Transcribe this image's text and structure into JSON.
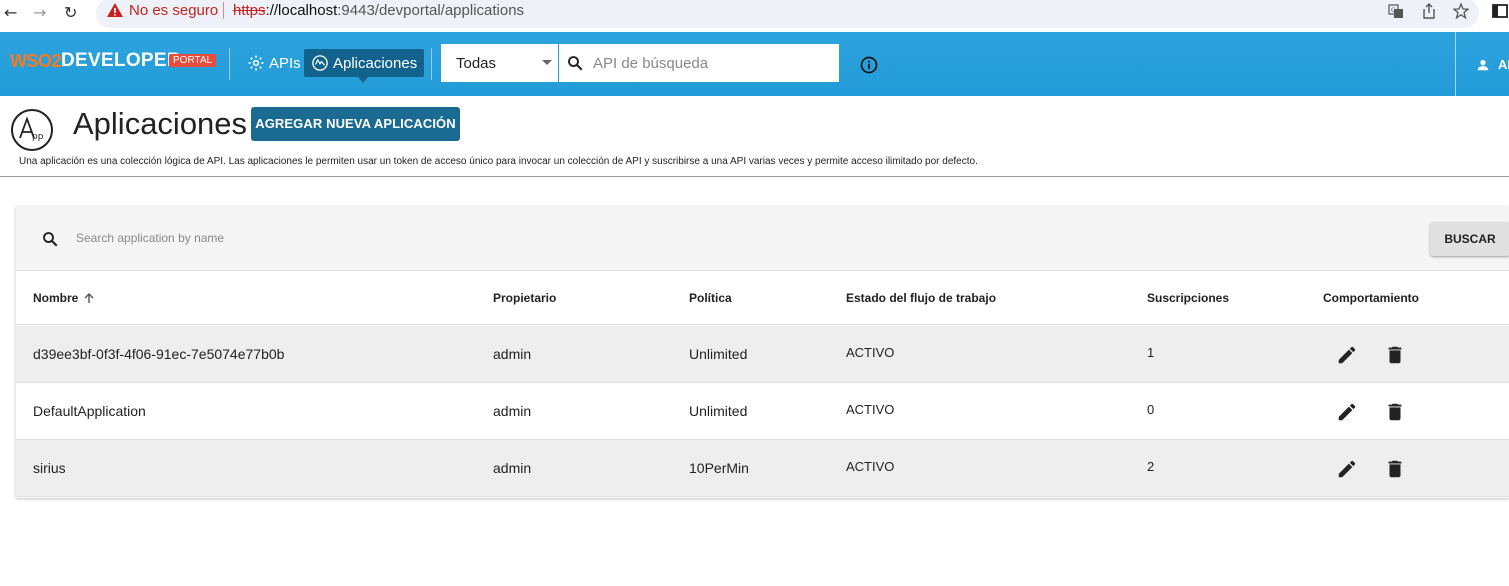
{
  "browser": {
    "insecure_label": "No es seguro",
    "url_scheme": "https",
    "url_host": "://localhost",
    "url_rest": ":9443/devportal/applications"
  },
  "header": {
    "logo_wso2": "WSO2",
    "logo_developer": "DEVELOPER",
    "logo_portal": "PORTAL",
    "nav": [
      {
        "label": "APIs",
        "icon": "gear-icon"
      },
      {
        "label": "Aplicaciones",
        "icon": "applications-icon"
      }
    ],
    "filter_selected": "Todas",
    "search_placeholder": "API de búsqueda",
    "user_initials": "AI"
  },
  "page": {
    "title": "Aplicaciones",
    "add_button": "AGREGAR NUEVA APLICACIÓN",
    "description": "Una aplicación es una colección lógica de API. Las aplicaciones le permiten usar un token de acceso único para invocar un colección de API y suscribirse a una API varias veces y permite acceso ilimitado por defecto."
  },
  "table": {
    "search_placeholder": "Search application by name",
    "search_button": "BUSCAR",
    "columns": [
      "Nombre",
      "Propietario",
      "Política",
      "Estado del flujo de trabajo",
      "Suscripciones",
      "Comportamiento"
    ],
    "rows": [
      {
        "name": "d39ee3bf-0f3f-4f06-91ec-7e5074e77b0b",
        "owner": "admin",
        "policy": "Unlimited",
        "status": "ACTIVO",
        "subscriptions": "1"
      },
      {
        "name": "DefaultApplication",
        "owner": "admin",
        "policy": "Unlimited",
        "status": "ACTIVO",
        "subscriptions": "0"
      },
      {
        "name": "sirius",
        "owner": "admin",
        "policy": "10PerMin",
        "status": "ACTIVO",
        "subscriptions": "2"
      }
    ]
  },
  "colors": {
    "header_blue": "#219bd7",
    "active_nav": "#11638e",
    "primary_button": "#1b6a92",
    "warning_red": "#c5221f"
  }
}
